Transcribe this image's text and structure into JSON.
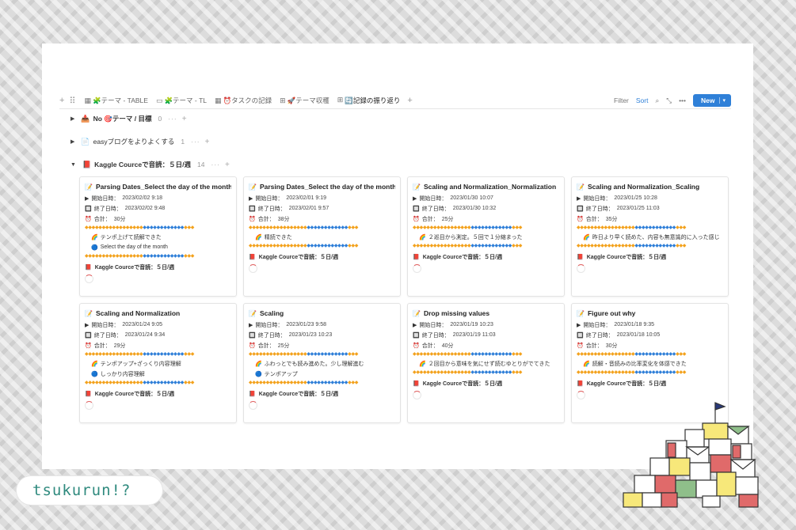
{
  "views": {
    "tabs": [
      {
        "icon": "table-icon",
        "glyph": "▦",
        "label": "🧩テーマ - TABLE",
        "active": false
      },
      {
        "icon": "timeline-icon",
        "glyph": "▭",
        "label": "🧩テーマ - TL",
        "active": false
      },
      {
        "icon": "table-icon",
        "glyph": "▦",
        "label": "⏰タスクの記録",
        "active": false
      },
      {
        "icon": "gallery-icon",
        "glyph": "⊞",
        "label": "🚀テーマ収穫",
        "active": false
      },
      {
        "icon": "gallery-icon",
        "glyph": "⊞",
        "label": "🔄記録の振り返り",
        "active": true
      }
    ],
    "filter": "Filter",
    "sort": "Sort",
    "new": "New"
  },
  "groups": [
    {
      "icon": "📥",
      "name": "No 🎯テーマ / 目標",
      "count": "0",
      "bold": true
    },
    {
      "icon": "📄",
      "name": "easyブログをよりよくする",
      "count": "1",
      "bold": false
    },
    {
      "icon": "📕",
      "name": "Kaggle Courceで音読：５日/週",
      "count": "14",
      "bold": true
    }
  ],
  "labels": {
    "start": "開始日時：",
    "end": "終了日時：",
    "total": "合計：",
    "relation": "Kaggle Courceで音読：５日/週"
  },
  "colors": {
    "accent": "#2f80d8",
    "diamond_orange": "#f3a21d",
    "diamond_blue": "#2f7fd8"
  },
  "cards": [
    {
      "title": "Parsing Dates_Select the day of the month",
      "start": "2023/02/02 9:18",
      "end": "2023/02/02 9:48",
      "total": "30分",
      "notes": [
        {
          "icon": "🌈",
          "text": "テンポ上げて読解できた"
        },
        {
          "icon": "🔵",
          "text": "Select the day of the month"
        }
      ]
    },
    {
      "title": "Parsing Dates_Select the day of the month",
      "start": "2023/02/01 9:19",
      "end": "2023/02/01 9:57",
      "total": "38分",
      "notes": [
        {
          "icon": "🌈",
          "text": "精読できた"
        }
      ]
    },
    {
      "title": "Scaling and Normalization_Normalization",
      "start": "2023/01/30 10:07",
      "end": "2023/01/30 10:32",
      "total": "25分",
      "notes": [
        {
          "icon": "🌈",
          "text": "２巡目から測定。５回で１分縮まった"
        }
      ]
    },
    {
      "title": "Scaling and Normalization_Scaling",
      "start": "2023/01/25 10:28",
      "end": "2023/01/25 11:03",
      "total": "35分",
      "notes": [
        {
          "icon": "🌈",
          "text": "昨日より早く読めた、内容も無意識的に入った感じ"
        }
      ]
    },
    {
      "title": "Scaling and Normalization",
      "start": "2023/01/24 9:05",
      "end": "2023/01/24 9:34",
      "total": "29分",
      "notes": [
        {
          "icon": "🌈",
          "text": "テンポアップ+ざっくり内容理解"
        },
        {
          "icon": "🔵",
          "text": "しっかり内容理解"
        }
      ]
    },
    {
      "title": "Scaling",
      "start": "2023/01/23 9:58",
      "end": "2023/01/23 10:23",
      "total": "25分",
      "notes": [
        {
          "icon": "🌈",
          "text": "ふわっとでも読み進めた。少し理解進む"
        },
        {
          "icon": "🔵",
          "text": "テンポアップ"
        }
      ]
    },
    {
      "title": "Drop missing values",
      "start": "2023/01/19 10:23",
      "end": "2023/01/19 11:03",
      "total": "40分",
      "notes": [
        {
          "icon": "🌈",
          "text": "２回目から意味を気にせず読むゆとりがでてきた"
        }
      ]
    },
    {
      "title": "Figure out why",
      "start": "2023/01/18 9:35",
      "end": "2023/01/18 10:05",
      "total": "30分",
      "notes": [
        {
          "icon": "🌈",
          "text": "読解・音読みの比率変化を体感できた"
        }
      ]
    }
  ],
  "brand": {
    "logo_text": "tsukurun!?"
  }
}
